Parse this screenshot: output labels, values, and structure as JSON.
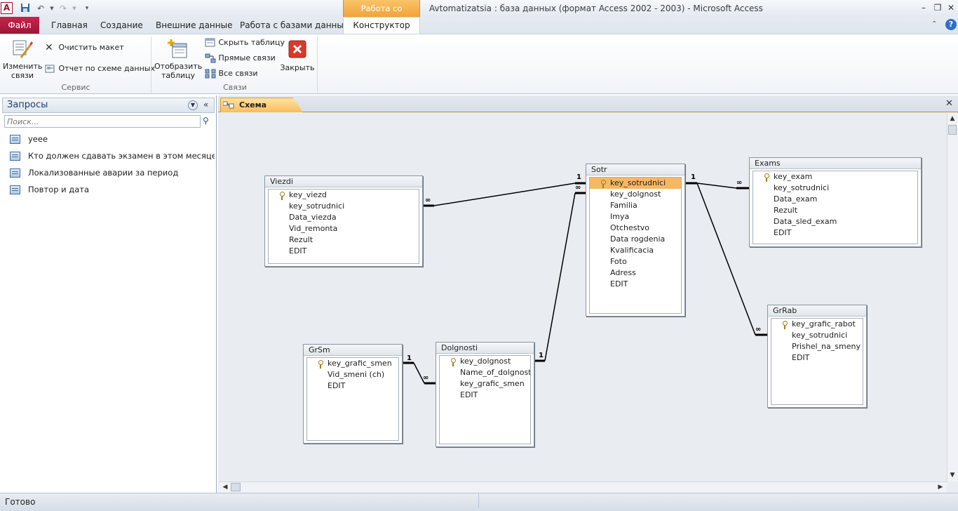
{
  "window": {
    "title": "Avtomatizatsia : база данных (формат Access 2002 - 2003)  -  Microsoft Access",
    "context_tab_header": "Работа со связями"
  },
  "ribbon_tabs": {
    "file": "Файл",
    "home": "Главная",
    "create": "Создание",
    "external": "Внешние данные",
    "database_tools": "Работа с базами данных",
    "constructor": "Конструктор"
  },
  "ribbon": {
    "edit_relations": [
      "Изменить",
      "связи"
    ],
    "clear_layout": "Очистить макет",
    "relationship_report": "Отчет по схеме данных",
    "group_service": "Сервис",
    "show_table": [
      "Отобразить",
      "таблицу"
    ],
    "hide_table": "Скрыть таблицу",
    "direct_relations": "Прямые связи",
    "all_relations": "Все связи",
    "close": "Закрыть",
    "group_relations": "Связи"
  },
  "nav_pane": {
    "title": "Запросы",
    "search_placeholder": "Поиск...",
    "items": [
      "уеее",
      "Кто должен сдавать экзамен в этом месяце и к...",
      "Локализованные аварии за период",
      "Повтор и дата"
    ]
  },
  "document": {
    "tab_label": "Схема данных"
  },
  "tables": {
    "viezdi": {
      "name": "Viezdi",
      "fields": [
        "key_viezd",
        "key_sotrudnici",
        "Data_viezda",
        "Vid_remonta",
        "Rezult",
        "EDIT"
      ]
    },
    "sotr": {
      "name": "Sotr",
      "fields": [
        "key_sotrudnici",
        "key_dolgnost",
        "Familia",
        "Imya",
        "Otchestvo",
        "Data rogdenia",
        "Kvalificacia",
        "Foto",
        "Adress",
        "EDIT"
      ]
    },
    "exams": {
      "name": "Exams",
      "fields": [
        "key_exam",
        "key_sotrudnici",
        "Data_exam",
        "Rezult",
        "Data_sled_exam",
        "EDIT"
      ]
    },
    "grrab": {
      "name": "GrRab",
      "fields": [
        "key_grafic_rabot",
        "key_sotrudnici",
        "Prishel_na_smeny",
        "EDIT"
      ]
    },
    "grsm": {
      "name": "GrSm",
      "fields": [
        "key_grafic_smen",
        "Vid_smeni (ch)",
        "EDIT"
      ]
    },
    "dolgnosti": {
      "name": "Dolgnosti",
      "fields": [
        "key_dolgnost",
        "Name_of_dolgnost",
        "key_grafic_smen",
        "EDIT"
      ]
    }
  },
  "relation_labels": {
    "one": "1",
    "many": "∞"
  },
  "status": {
    "text": "Готово"
  }
}
